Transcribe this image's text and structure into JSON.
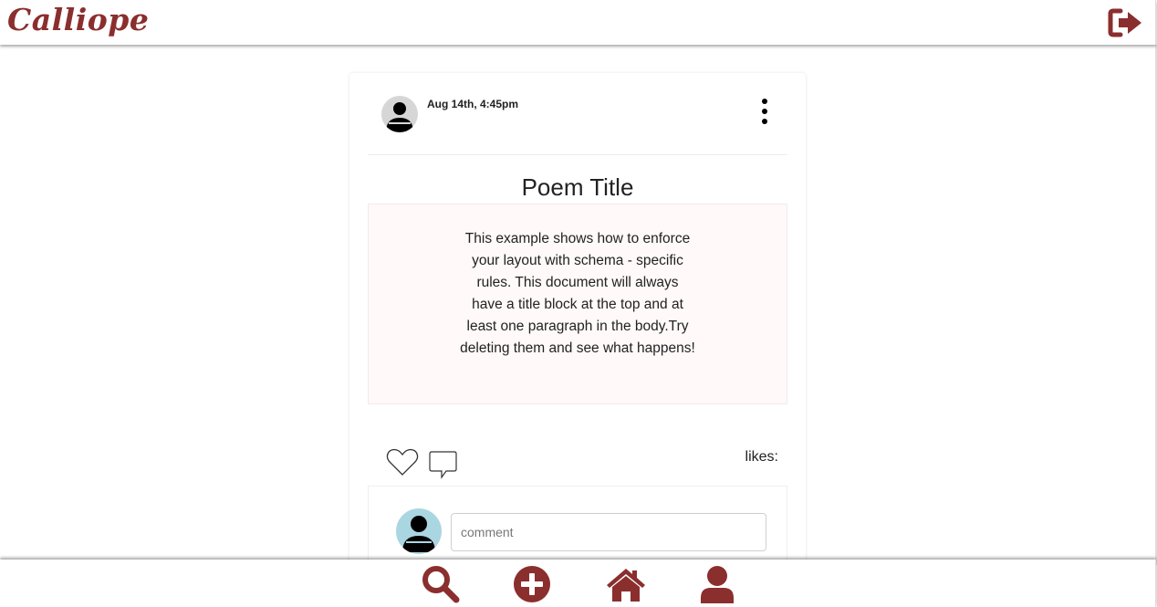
{
  "app": {
    "logo_text": "Calliope",
    "brand_color": "#8b2e2e"
  },
  "header": {
    "logout_icon": "sign-out-icon"
  },
  "post": {
    "timestamp": "Aug 14th, 4:45pm",
    "menu_icon": "vertical-ellipsis-icon",
    "title": "Poem Title",
    "body": "This example shows how to enforce your layout with schema - specific rules. This document will always have a title block at the top and at least one paragraph in the body.Try deleting them and see what happens!",
    "likes_label": "likes:",
    "like_icon": "heart-outline-icon",
    "comment_icon": "speech-bubble-icon"
  },
  "comment": {
    "placeholder": "comment",
    "value": ""
  },
  "bottom_nav": {
    "items": [
      {
        "icon": "search-icon"
      },
      {
        "icon": "plus-circle-icon"
      },
      {
        "icon": "home-icon"
      },
      {
        "icon": "user-icon"
      }
    ]
  }
}
